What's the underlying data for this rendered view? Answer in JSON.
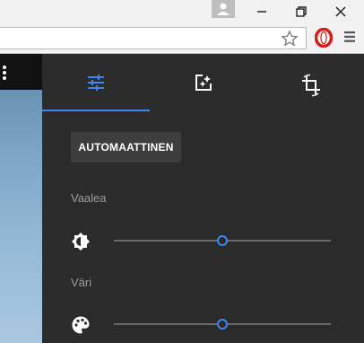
{
  "browser": {
    "profile_icon": "person-icon",
    "window_controls": [
      "minimize-icon",
      "restore-icon",
      "close-icon"
    ],
    "address_bar": {
      "value": "",
      "bookmark_icon": "star-icon"
    },
    "extension_icon": "opera-icon",
    "menu_icon": "hamburger-menu-icon"
  },
  "photo": {
    "menu_icon": "more-vertical-icon"
  },
  "editor": {
    "tabs": [
      {
        "name": "adjustments",
        "icon": "tune-icon",
        "active": true
      },
      {
        "name": "filters",
        "icon": "photo-filter-icon",
        "active": false
      },
      {
        "name": "crop",
        "icon": "crop-rotate-icon",
        "active": false
      }
    ],
    "accent_color": "#4285f4",
    "auto_button_label": "AUTOMAATTINEN",
    "sections": [
      {
        "label": "Vaalea",
        "icon": "brightness-icon",
        "slider_value": 0.5
      },
      {
        "label": "Väri",
        "icon": "palette-icon",
        "slider_value": 0.5
      }
    ]
  }
}
